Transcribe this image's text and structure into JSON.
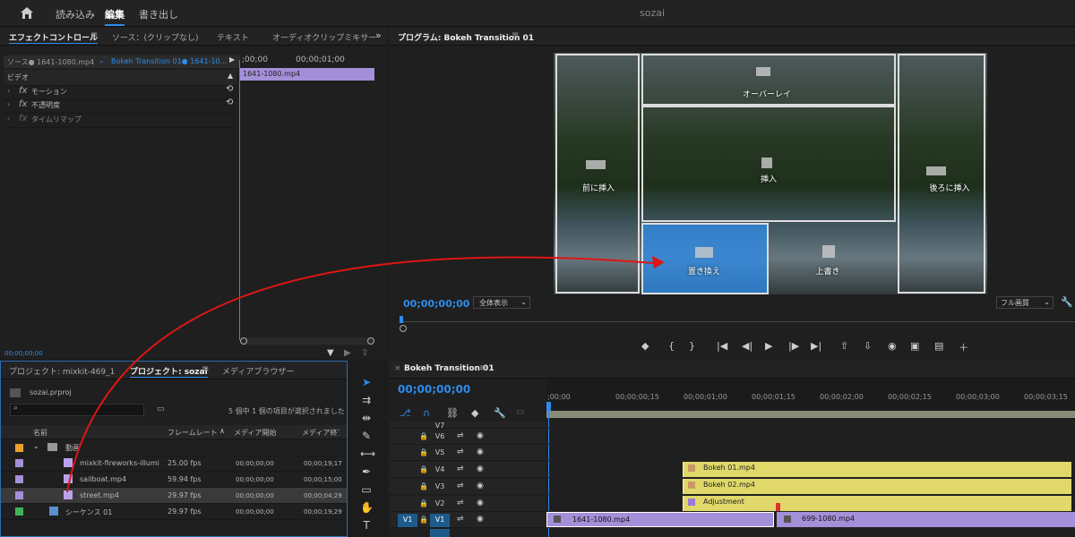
{
  "topbar": {
    "home_icon": "home-icon",
    "ws_read": "読み込み",
    "ws_edit": "編集",
    "ws_export": "書き出し",
    "project_name": "sozai"
  },
  "effect_panel": {
    "tab_effect_controls": "エフェクトコントロール",
    "tab_source": "ソース：(クリップなし)",
    "tab_text": "テキスト",
    "tab_audio_mixer": "オーディオクリップミキサー",
    "source_label": "ソース● 1641-1080.mp4",
    "sequence_label": "Bokeh Transition 01● 1641-10...",
    "tc_start": ";00;00",
    "tc_end": "00;00;01;00",
    "clip_name": "1641-1080.mp4",
    "video_header": "ビデオ",
    "motion": "モーション",
    "opacity": "不透明度",
    "time_remap": "タイムリマップ",
    "fx": "fx",
    "footer_tc": "00;00;00;00"
  },
  "program": {
    "title": "プログラム: Bokeh Transition 01",
    "timecode": "00;00;00;00",
    "zoom": "全体表示",
    "quality": "フル画質",
    "overlay_labels": {
      "overlay": "オーバーレイ",
      "insert_before": "前に挿入",
      "insert": "挿入",
      "insert_after": "後ろに挿入",
      "replace": "置き換え",
      "overwrite": "上書き"
    }
  },
  "project": {
    "tab_project1": "プロジェクト: mixkit-469_1",
    "tab_project2": "プロジェクト: sozai",
    "tab_media_browser": "メディアブラウザー",
    "file": "sozai.prproj",
    "selection_status": "5 個中 1 個の項目が選択されました",
    "columns": {
      "name": "名前",
      "frame_rate": "フレームレート",
      "media_start": "メディア開始",
      "media_end": "メディア終了"
    },
    "folder": "動画",
    "items": [
      {
        "name": "mixkit-fireworks-illumi",
        "fps": "25.00 fps",
        "start": "00;00;00;00",
        "end": "00;00;19;17",
        "color": "#a48fd9"
      },
      {
        "name": "sailboat.mp4",
        "fps": "59.94 fps",
        "start": "00;00;00;00",
        "end": "00;00;15;00",
        "color": "#a48fd9"
      },
      {
        "name": "street.mp4",
        "fps": "29.97 fps",
        "start": "00;00;00;00",
        "end": "00;00;04;29",
        "color": "#a48fd9"
      },
      {
        "name": "シーケンス 01",
        "fps": "29.97 fps",
        "start": "00;00;00;00",
        "end": "00;00;19;29",
        "color": "#3fb35a"
      }
    ]
  },
  "timeline": {
    "title": "Bokeh Transition 01",
    "timecode": "00;00;00;00",
    "ruler": [
      ";00;00",
      "00;00;00;15",
      "00;00;01;00",
      "00;00;01;15",
      "00;00;02;00",
      "00;00;02;15",
      "00;00;03;00",
      "00;00;03;15"
    ],
    "tracks": [
      "V7",
      "V6",
      "V5",
      "V4",
      "V3",
      "V2",
      "V1"
    ],
    "src_patch": "V1",
    "clips": {
      "bokeh1": "Bokeh 01.mp4",
      "bokeh2": "Bokeh 02.mp4",
      "adjustment": "Adjustment",
      "v1a": "1641-1080.mp4",
      "v1b": "699-1080.mp4"
    }
  }
}
